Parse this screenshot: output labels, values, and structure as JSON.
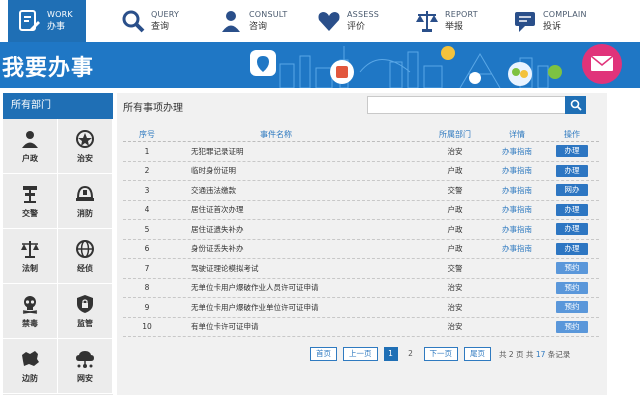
{
  "nav": [
    {
      "en": "WORK",
      "cn": "办事"
    },
    {
      "en": "QUERY",
      "cn": "查询"
    },
    {
      "en": "CONSULT",
      "cn": "咨询"
    },
    {
      "en": "ASSESS",
      "cn": "评价"
    },
    {
      "en": "REPORT",
      "cn": "举报"
    },
    {
      "en": "COMPLAIN",
      "cn": "投诉"
    }
  ],
  "banner": {
    "title": "我要办事"
  },
  "sidebar": {
    "header": "所有部门",
    "items": [
      {
        "label": "户政",
        "icon": "person-icon"
      },
      {
        "label": "治安",
        "icon": "police-badge-icon"
      },
      {
        "label": "交警",
        "icon": "traffic-police-icon"
      },
      {
        "label": "消防",
        "icon": "fire-helmet-icon"
      },
      {
        "label": "法制",
        "icon": "scales-icon"
      },
      {
        "label": "经侦",
        "icon": "globe-money-icon"
      },
      {
        "label": "禁毒",
        "icon": "skull-icon"
      },
      {
        "label": "监管",
        "icon": "shield-lock-icon"
      },
      {
        "label": "边防",
        "icon": "map-icon"
      },
      {
        "label": "网安",
        "icon": "network-cloud-icon"
      }
    ]
  },
  "main": {
    "title": "所有事项办理",
    "search": {
      "placeholder": "",
      "value": ""
    },
    "columns": [
      "序号",
      "事件名称",
      "所属部门",
      "详情",
      "操作"
    ],
    "rows": [
      {
        "no": "1",
        "name": "无犯罪记录证明",
        "dept": "治安",
        "guide": "办事指南",
        "op": "办理",
        "opType": "handle"
      },
      {
        "no": "2",
        "name": "临时身份证明",
        "dept": "户政",
        "guide": "办事指南",
        "op": "办理",
        "opType": "handle"
      },
      {
        "no": "3",
        "name": "交通违法缴款",
        "dept": "交警",
        "guide": "办事指南",
        "op": "网办",
        "opType": "handle"
      },
      {
        "no": "4",
        "name": "居住证首次办理",
        "dept": "户政",
        "guide": "办事指南",
        "op": "办理",
        "opType": "handle"
      },
      {
        "no": "5",
        "name": "居住证遗失补办",
        "dept": "户政",
        "guide": "办事指南",
        "op": "办理",
        "opType": "handle"
      },
      {
        "no": "6",
        "name": "身份证丢失补办",
        "dept": "户政",
        "guide": "办事指南",
        "op": "办理",
        "opType": "handle"
      },
      {
        "no": "7",
        "name": "驾驶证理论模拟考试",
        "dept": "交警",
        "guide": "",
        "op": "预约",
        "opType": "reserve"
      },
      {
        "no": "8",
        "name": "无单位卡用户爆破作业人员许可证申请",
        "dept": "治安",
        "guide": "",
        "op": "预约",
        "opType": "reserve"
      },
      {
        "no": "9",
        "name": "无单位卡用户爆破作业单位许可证申请",
        "dept": "治安",
        "guide": "",
        "op": "预约",
        "opType": "reserve"
      },
      {
        "no": "10",
        "name": "有单位卡许可证申请",
        "dept": "治安",
        "guide": "",
        "op": "预约",
        "opType": "reserve"
      }
    ],
    "pager": {
      "first": "首页",
      "prev": "上一页",
      "pages": [
        "1",
        "2"
      ],
      "current": "1",
      "next": "下一页",
      "last": "尾页",
      "info_prefix": "共 2 页 共",
      "total": "17",
      "info_suffix": "条记录"
    }
  },
  "colors": {
    "primary": "#1f6fb5",
    "banner": "#1f77c5",
    "link": "#2f7ac0",
    "reserve": "#5a97da"
  }
}
